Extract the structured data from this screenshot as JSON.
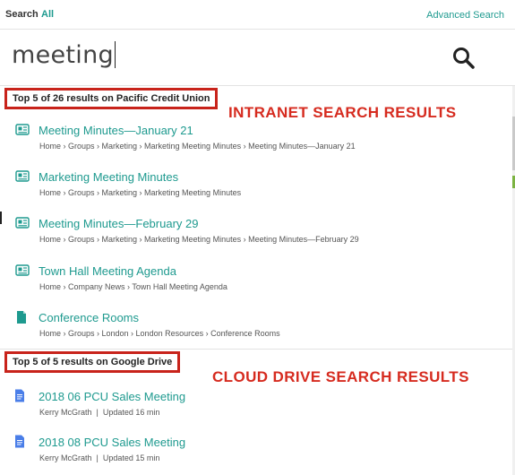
{
  "topbar": {
    "search_label": "Search",
    "scope": "All",
    "advanced": "Advanced Search"
  },
  "search": {
    "query": "meeting"
  },
  "intranet": {
    "header": "Top 5 of 26 results on Pacific Credit Union",
    "annotation": "INTRANET SEARCH RESULTS",
    "results": [
      {
        "title": "Meeting Minutes—January 21",
        "path": "Home › Groups › Marketing › Marketing Meeting Minutes › Meeting Minutes—January 21",
        "icon": "news-icon"
      },
      {
        "title": "Marketing Meeting Minutes",
        "path": "Home › Groups › Marketing › Marketing Meeting Minutes",
        "icon": "news-icon"
      },
      {
        "title": "Meeting Minutes—February 29",
        "path": "Home › Groups › Marketing › Marketing Meeting Minutes › Meeting Minutes—February 29",
        "icon": "news-icon"
      },
      {
        "title": "Town Hall Meeting Agenda",
        "path": "Home › Company News › Town Hall Meeting Agenda",
        "icon": "news-icon"
      },
      {
        "title": "Conference Rooms",
        "path": "Home › Groups › London › London Resources › Conference Rooms",
        "icon": "page-icon"
      }
    ]
  },
  "drive": {
    "header": "Top 5 of 5 results on Google Drive",
    "annotation": "CLOUD DRIVE SEARCH RESULTS",
    "results": [
      {
        "title": "2018 06 PCU Sales Meeting",
        "meta": "Kerry McGrath  |  Updated 16 min",
        "icon": "google-doc-icon"
      },
      {
        "title": "2018 08 PCU Sales Meeting",
        "meta": "Kerry McGrath  |  Updated 15 min",
        "icon": "google-doc-icon"
      }
    ]
  },
  "colors": {
    "accent": "#1e9a8f",
    "annotation": "#d62b1f",
    "doc_blue": "#4a7ee8"
  }
}
